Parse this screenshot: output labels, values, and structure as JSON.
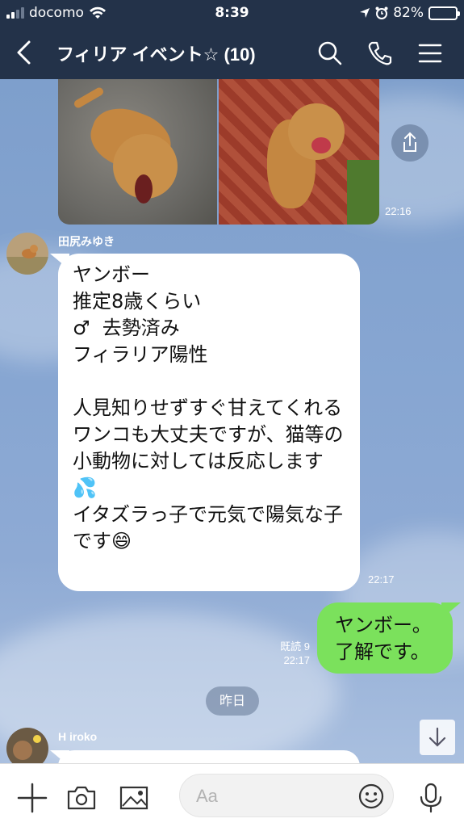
{
  "status_bar": {
    "carrier": "docomo",
    "time": "8:39",
    "battery": "82%",
    "battery_level": 0.82
  },
  "header": {
    "title": "フィリア イベント☆ (10)",
    "icons": [
      "back-chevron-icon",
      "search-icon",
      "phone-icon",
      "menu-icon"
    ]
  },
  "messages": {
    "photo_time": "22:16",
    "msg1": {
      "sender": "田尻みゆき",
      "text": "ヤンボー\n推定8歳くらい\n♂  去勢済み\nフィラリア陽性\n\n人見知りせずすぐ甘えてくれる\nワンコも大丈夫ですが、猫等の小動物に対しては反応します💦\nイタズラっ子で元気で陽気な子です😄",
      "time": "22:17"
    },
    "msg2": {
      "text": "ヤンボー。\n了解です。",
      "read": "既読 9",
      "time": "22:17"
    },
    "day_separator": "昨日",
    "msg3": {
      "sender": "H iroko"
    }
  },
  "input_bar": {
    "placeholder": "Aa",
    "icons": [
      "plus-icon",
      "camera-icon",
      "image-icon",
      "emoji-icon",
      "microphone-icon"
    ]
  },
  "colors": {
    "header_bg": "#233249",
    "outgoing_bubble": "#7be15c",
    "incoming_bubble": "#ffffff",
    "chat_bg": "#7e9fcc"
  }
}
